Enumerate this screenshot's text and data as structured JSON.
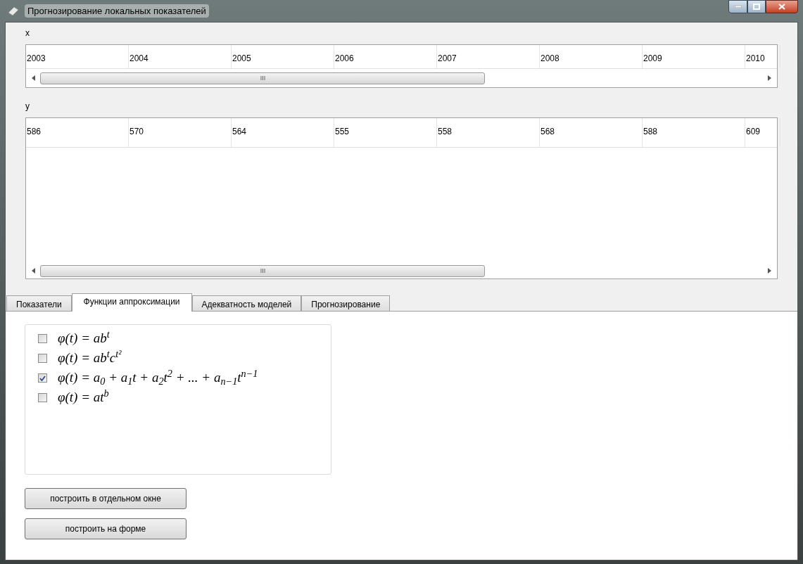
{
  "window": {
    "title": "Прогнозирование локальных показателей"
  },
  "x_label": "x",
  "x_row": [
    "2003",
    "2004",
    "2005",
    "2006",
    "2007",
    "2008",
    "2009",
    "2010"
  ],
  "y_label": "y",
  "y_row": [
    "586",
    "570",
    "564",
    "555",
    "558",
    "568",
    "588",
    "609"
  ],
  "tabs": [
    {
      "label": "Показатели",
      "selected": false
    },
    {
      "label": "Функции аппроксимации",
      "selected": true
    },
    {
      "label": "Адекватность моделей",
      "selected": false
    },
    {
      "label": "Прогнозирование",
      "selected": false
    }
  ],
  "functions": [
    {
      "formula": "φ(t) = ab$^{t}$",
      "checked": false
    },
    {
      "formula": "φ(t) = ab$^{t}$c$^{t²}$",
      "checked": false
    },
    {
      "formula": "φ(t) = a$_{0}$ + a$_{1}$t + a$_{2}$t$^{2}$ + ... + a$_{n−1}$t$^{n−1}$",
      "checked": true
    },
    {
      "formula": "φ(t) = at$^{b}$",
      "checked": false
    }
  ],
  "buttons": [
    "построить в отдельном окне",
    "построить на форме"
  ]
}
